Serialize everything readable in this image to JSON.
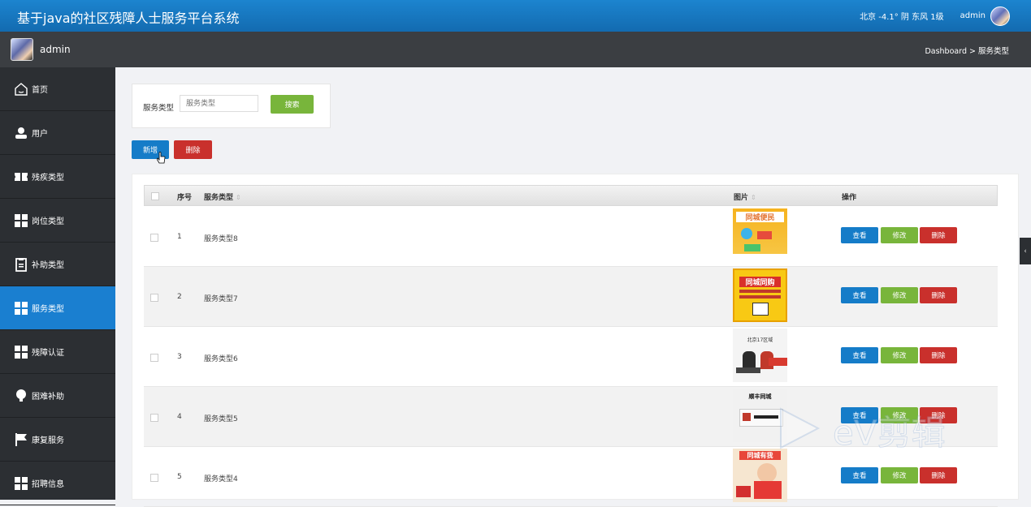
{
  "header": {
    "title": "基于java的社区残障人士服务平台系统",
    "weather": "北京  -4.1°  阴  东风  1级",
    "user": "admin"
  },
  "subheader": {
    "username": "admin",
    "breadcrumb": "Dashboard > 服务类型"
  },
  "sidebar": {
    "items": [
      {
        "label": "首页",
        "icon": "home-icon"
      },
      {
        "label": "用户",
        "icon": "user-icon"
      },
      {
        "label": "残疾类型",
        "icon": "ticket-icon"
      },
      {
        "label": "岗位类型",
        "icon": "grid-icon"
      },
      {
        "label": "补助类型",
        "icon": "clipboard-icon"
      },
      {
        "label": "服务类型",
        "icon": "grid-icon",
        "active": true
      },
      {
        "label": "残障认证",
        "icon": "grid-icon"
      },
      {
        "label": "困难补助",
        "icon": "bulb-icon"
      },
      {
        "label": "康复服务",
        "icon": "flag-icon"
      },
      {
        "label": "招聘信息",
        "icon": "grid-icon"
      }
    ]
  },
  "search": {
    "label": "服务类型",
    "placeholder": "服务类型",
    "button": "搜索"
  },
  "actions": {
    "add": "新增",
    "delete": "删除"
  },
  "table": {
    "columns": {
      "index": "序号",
      "name": "服务类型",
      "image": "图片",
      "ops": "操作"
    },
    "row_buttons": {
      "view": "查看",
      "edit": "修改",
      "delete": "删除"
    },
    "rows": [
      {
        "index": "1",
        "name": "服务类型8",
        "thumb_text": "同城便民"
      },
      {
        "index": "2",
        "name": "服务类型7",
        "thumb_text": "同城同购"
      },
      {
        "index": "3",
        "name": "服务类型6",
        "thumb_text": "北京17区域"
      },
      {
        "index": "4",
        "name": "服务类型5",
        "thumb_text": "顺丰同城"
      },
      {
        "index": "5",
        "name": "服务类型4",
        "thumb_text": "同城有我"
      }
    ]
  },
  "watermark": "eV剪辑",
  "colors": {
    "topbar": "#1679c2",
    "sidebar": "#2c2f33",
    "active": "#1a7fd0",
    "green": "#78b53b",
    "red": "#c9302c",
    "blue": "#157cc8"
  }
}
